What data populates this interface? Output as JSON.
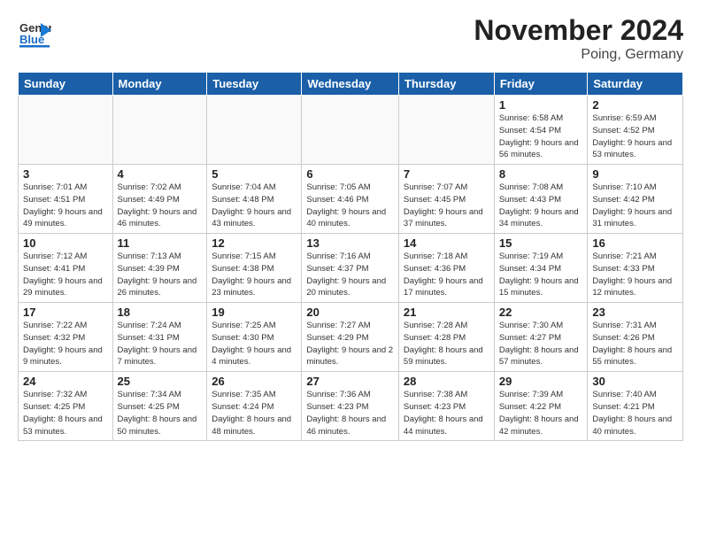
{
  "header": {
    "title": "November 2024",
    "subtitle": "Poing, Germany"
  },
  "logo": {
    "general": "General",
    "blue": "Blue"
  },
  "days_of_week": [
    "Sunday",
    "Monday",
    "Tuesday",
    "Wednesday",
    "Thursday",
    "Friday",
    "Saturday"
  ],
  "weeks": [
    {
      "days": [
        {
          "num": "",
          "info": ""
        },
        {
          "num": "",
          "info": ""
        },
        {
          "num": "",
          "info": ""
        },
        {
          "num": "",
          "info": ""
        },
        {
          "num": "",
          "info": ""
        },
        {
          "num": "1",
          "info": "Sunrise: 6:58 AM\nSunset: 4:54 PM\nDaylight: 9 hours\nand 56 minutes."
        },
        {
          "num": "2",
          "info": "Sunrise: 6:59 AM\nSunset: 4:52 PM\nDaylight: 9 hours\nand 53 minutes."
        }
      ]
    },
    {
      "days": [
        {
          "num": "3",
          "info": "Sunrise: 7:01 AM\nSunset: 4:51 PM\nDaylight: 9 hours\nand 49 minutes."
        },
        {
          "num": "4",
          "info": "Sunrise: 7:02 AM\nSunset: 4:49 PM\nDaylight: 9 hours\nand 46 minutes."
        },
        {
          "num": "5",
          "info": "Sunrise: 7:04 AM\nSunset: 4:48 PM\nDaylight: 9 hours\nand 43 minutes."
        },
        {
          "num": "6",
          "info": "Sunrise: 7:05 AM\nSunset: 4:46 PM\nDaylight: 9 hours\nand 40 minutes."
        },
        {
          "num": "7",
          "info": "Sunrise: 7:07 AM\nSunset: 4:45 PM\nDaylight: 9 hours\nand 37 minutes."
        },
        {
          "num": "8",
          "info": "Sunrise: 7:08 AM\nSunset: 4:43 PM\nDaylight: 9 hours\nand 34 minutes."
        },
        {
          "num": "9",
          "info": "Sunrise: 7:10 AM\nSunset: 4:42 PM\nDaylight: 9 hours\nand 31 minutes."
        }
      ]
    },
    {
      "days": [
        {
          "num": "10",
          "info": "Sunrise: 7:12 AM\nSunset: 4:41 PM\nDaylight: 9 hours\nand 29 minutes."
        },
        {
          "num": "11",
          "info": "Sunrise: 7:13 AM\nSunset: 4:39 PM\nDaylight: 9 hours\nand 26 minutes."
        },
        {
          "num": "12",
          "info": "Sunrise: 7:15 AM\nSunset: 4:38 PM\nDaylight: 9 hours\nand 23 minutes."
        },
        {
          "num": "13",
          "info": "Sunrise: 7:16 AM\nSunset: 4:37 PM\nDaylight: 9 hours\nand 20 minutes."
        },
        {
          "num": "14",
          "info": "Sunrise: 7:18 AM\nSunset: 4:36 PM\nDaylight: 9 hours\nand 17 minutes."
        },
        {
          "num": "15",
          "info": "Sunrise: 7:19 AM\nSunset: 4:34 PM\nDaylight: 9 hours\nand 15 minutes."
        },
        {
          "num": "16",
          "info": "Sunrise: 7:21 AM\nSunset: 4:33 PM\nDaylight: 9 hours\nand 12 minutes."
        }
      ]
    },
    {
      "days": [
        {
          "num": "17",
          "info": "Sunrise: 7:22 AM\nSunset: 4:32 PM\nDaylight: 9 hours\nand 9 minutes."
        },
        {
          "num": "18",
          "info": "Sunrise: 7:24 AM\nSunset: 4:31 PM\nDaylight: 9 hours\nand 7 minutes."
        },
        {
          "num": "19",
          "info": "Sunrise: 7:25 AM\nSunset: 4:30 PM\nDaylight: 9 hours\nand 4 minutes."
        },
        {
          "num": "20",
          "info": "Sunrise: 7:27 AM\nSunset: 4:29 PM\nDaylight: 9 hours\nand 2 minutes."
        },
        {
          "num": "21",
          "info": "Sunrise: 7:28 AM\nSunset: 4:28 PM\nDaylight: 8 hours\nand 59 minutes."
        },
        {
          "num": "22",
          "info": "Sunrise: 7:30 AM\nSunset: 4:27 PM\nDaylight: 8 hours\nand 57 minutes."
        },
        {
          "num": "23",
          "info": "Sunrise: 7:31 AM\nSunset: 4:26 PM\nDaylight: 8 hours\nand 55 minutes."
        }
      ]
    },
    {
      "days": [
        {
          "num": "24",
          "info": "Sunrise: 7:32 AM\nSunset: 4:25 PM\nDaylight: 8 hours\nand 53 minutes."
        },
        {
          "num": "25",
          "info": "Sunrise: 7:34 AM\nSunset: 4:25 PM\nDaylight: 8 hours\nand 50 minutes."
        },
        {
          "num": "26",
          "info": "Sunrise: 7:35 AM\nSunset: 4:24 PM\nDaylight: 8 hours\nand 48 minutes."
        },
        {
          "num": "27",
          "info": "Sunrise: 7:36 AM\nSunset: 4:23 PM\nDaylight: 8 hours\nand 46 minutes."
        },
        {
          "num": "28",
          "info": "Sunrise: 7:38 AM\nSunset: 4:23 PM\nDaylight: 8 hours\nand 44 minutes."
        },
        {
          "num": "29",
          "info": "Sunrise: 7:39 AM\nSunset: 4:22 PM\nDaylight: 8 hours\nand 42 minutes."
        },
        {
          "num": "30",
          "info": "Sunrise: 7:40 AM\nSunset: 4:21 PM\nDaylight: 8 hours\nand 40 minutes."
        }
      ]
    }
  ]
}
